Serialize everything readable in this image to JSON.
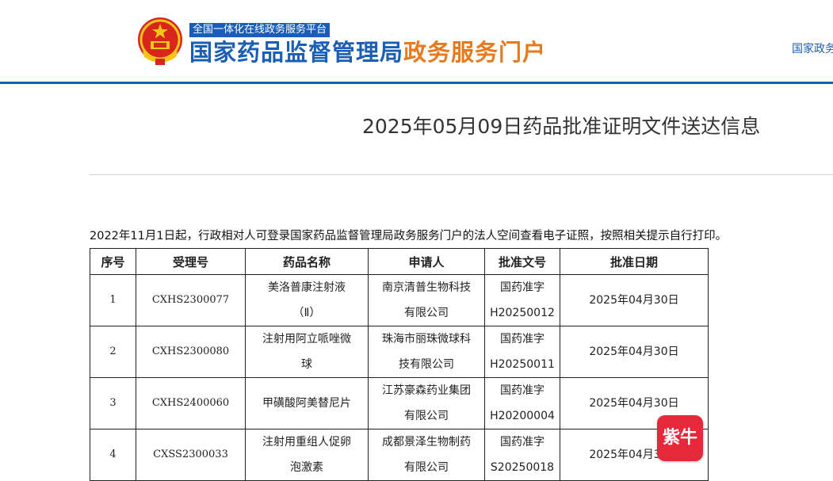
{
  "header": {
    "platform_badge": "全国一体化在线政务服务平台",
    "title_main": "国家药品监督管理局",
    "title_accent": "政务服务门户",
    "top_link": "国家政务",
    "colors": {
      "brand_blue": "#1a5fb4",
      "accent_orange": "#e87a1e"
    }
  },
  "page": {
    "title": "2025年05月09日药品批准证明文件送达信息",
    "notice": "2022年11月1日起，行政相对人可登录国家药品监督管理局政务服务门户的法人空间查看电子证照，按照相关提示自行打印。"
  },
  "table": {
    "headers": [
      "序号",
      "受理号",
      "药品名称",
      "申请人",
      "批准文号",
      "批准日期"
    ],
    "rows": [
      {
        "seq": "1",
        "acceptance_no": "CXHS2300077",
        "drug_name": [
          "美洛普康注射液",
          "（Ⅱ）"
        ],
        "applicant": [
          "南京清普生物科技",
          "有限公司"
        ],
        "approval_no": [
          "国药准字",
          "H20250012"
        ],
        "approval_date": "2025年04月30日"
      },
      {
        "seq": "2",
        "acceptance_no": "CXHS2300080",
        "drug_name": [
          "注射用阿立哌唑微",
          "球"
        ],
        "applicant": [
          "珠海市丽珠微球科",
          "技有限公司"
        ],
        "approval_no": [
          "国药准字",
          "H20250011"
        ],
        "approval_date": "2025年04月30日"
      },
      {
        "seq": "3",
        "acceptance_no": "CXHS2400060",
        "drug_name": [
          "甲磺酸阿美替尼片"
        ],
        "applicant": [
          "江苏豪森药业集团",
          "有限公司"
        ],
        "approval_no": [
          "国药准字",
          "H20200004"
        ],
        "approval_date": "2025年04月30日"
      },
      {
        "seq": "4",
        "acceptance_no": "CXSS2300033",
        "drug_name": [
          "注射用重组人促卵",
          "泡激素"
        ],
        "applicant": [
          "成都景泽生物制药",
          "有限公司"
        ],
        "approval_no": [
          "国药准字",
          "S20250018"
        ],
        "approval_date": "2025年04月30日"
      }
    ]
  },
  "watermark": {
    "text": "紫牛",
    "icon": "news-app-logo"
  }
}
